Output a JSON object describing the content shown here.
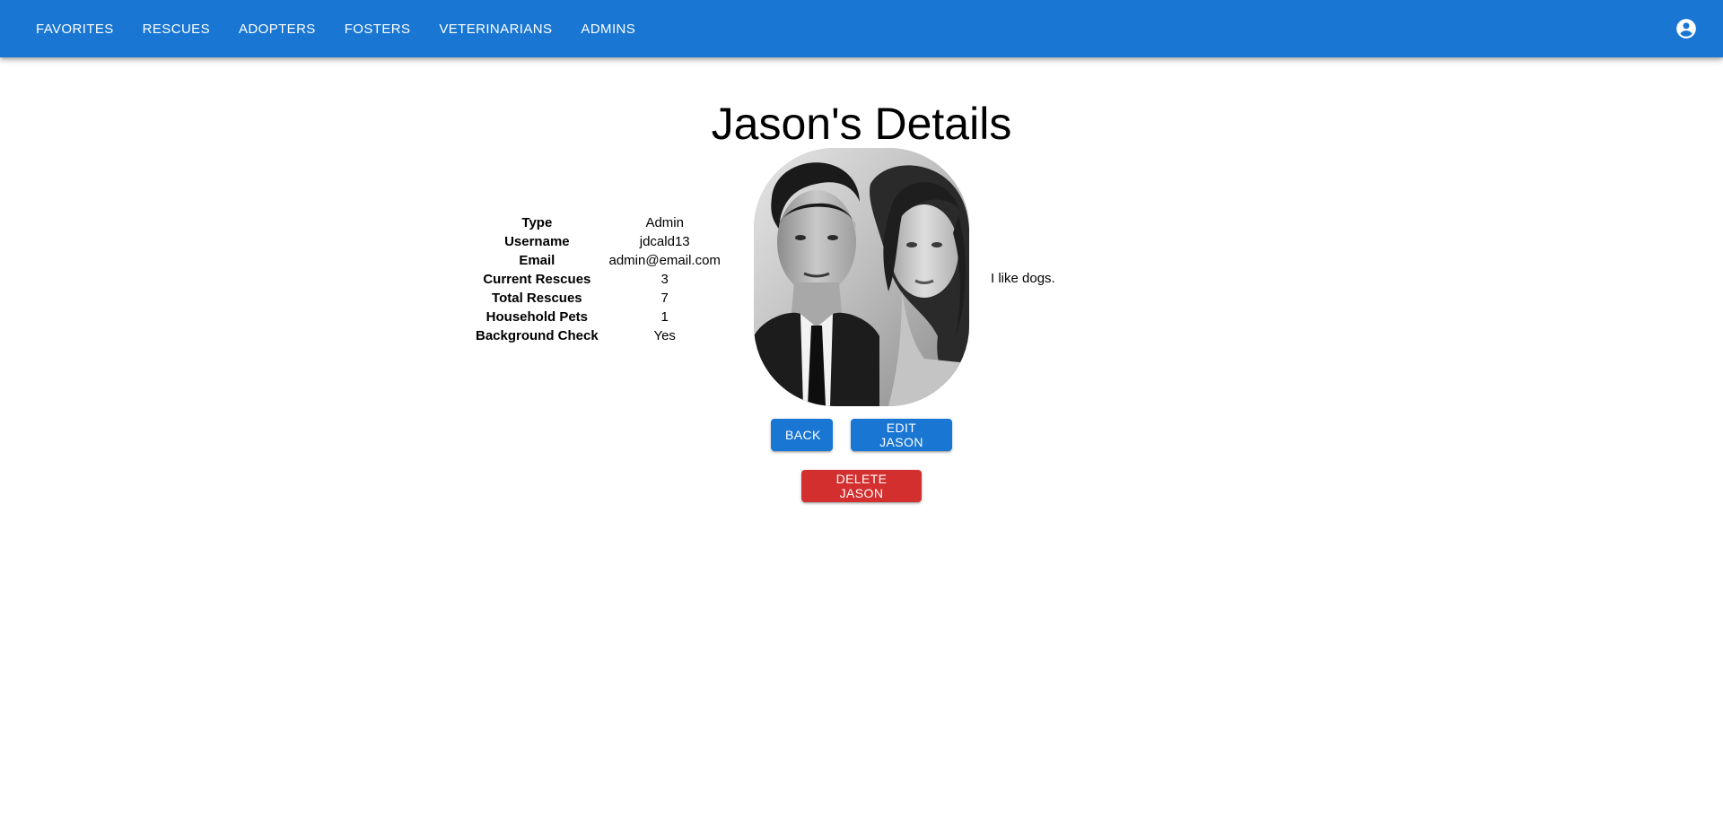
{
  "nav": {
    "items": [
      "FAVORITES",
      "RESCUES",
      "ADOPTERS",
      "FOSTERS",
      "VETERINARIANS",
      "ADMINS"
    ],
    "account_icon": "account-circle-icon"
  },
  "page": {
    "title": "Jason's Details",
    "bio": "I like dogs.",
    "portrait_alt": "profile photo"
  },
  "details": [
    {
      "label": "Type",
      "value": "Admin"
    },
    {
      "label": "Username",
      "value": "jdcald13"
    },
    {
      "label": "Email",
      "value": "admin@email.com"
    },
    {
      "label": "Current Rescues",
      "value": "3"
    },
    {
      "label": "Total Rescues",
      "value": "7"
    },
    {
      "label": "Household Pets",
      "value": "1"
    },
    {
      "label": "Background Check",
      "value": "Yes"
    }
  ],
  "buttons": {
    "back": "BACK",
    "edit": "EDIT JASON",
    "delete": "DELETE JASON"
  },
  "colors": {
    "primary": "#1976d2",
    "danger": "#d32f2f"
  }
}
